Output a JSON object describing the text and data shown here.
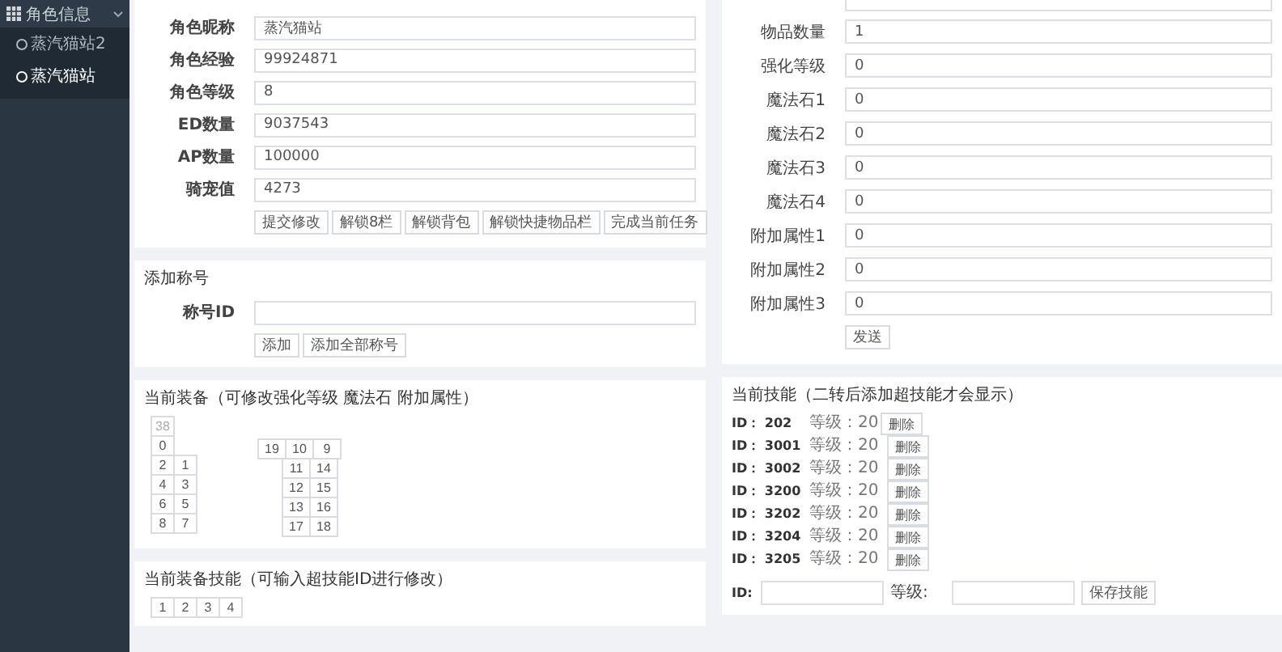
{
  "sidebar": {
    "title": "角色信息",
    "expanded": true,
    "items": [
      {
        "label": "蒸汽猫站2",
        "selected": false
      },
      {
        "label": "蒸汽猫站",
        "selected": true
      }
    ]
  },
  "character_form": {
    "fields": [
      {
        "label": "角色昵称",
        "value": "蒸汽猫站"
      },
      {
        "label": "角色经验",
        "value": "99924871"
      },
      {
        "label": "角色等级",
        "value": "8"
      },
      {
        "label": "ED数量",
        "value": "9037543"
      },
      {
        "label": "AP数量",
        "value": "100000"
      },
      {
        "label": "骑宠值",
        "value": "4273"
      }
    ],
    "buttons": [
      "提交修改",
      "解锁8栏",
      "解锁背包",
      "解锁快捷物品栏",
      "完成当前任务"
    ]
  },
  "title_form": {
    "heading": "添加称号",
    "field_label": "称号ID",
    "buttons": [
      "添加",
      "添加全部称号"
    ]
  },
  "equipment": {
    "heading": "当前装备（可修改强化等级 魔法石 附加属性）",
    "left_rows": [
      [
        {
          "label": "38",
          "disabled": true
        }
      ],
      [
        {
          "label": "0",
          "disabled": false
        }
      ],
      [
        {
          "label": "2",
          "disabled": false
        },
        {
          "label": "1",
          "disabled": false
        }
      ],
      [
        {
          "label": "4",
          "disabled": false
        },
        {
          "label": "3",
          "disabled": false
        }
      ],
      [
        {
          "label": "6",
          "disabled": false
        },
        {
          "label": "5",
          "disabled": false
        }
      ],
      [
        {
          "label": "8",
          "disabled": false
        },
        {
          "label": "7",
          "disabled": false
        }
      ]
    ],
    "right_rows": [
      [
        {
          "label": "19",
          "disabled": false
        },
        {
          "label": "10",
          "disabled": false
        },
        {
          "label": "9",
          "disabled": false
        }
      ],
      [
        {
          "label": "11",
          "disabled": false
        },
        {
          "label": "14",
          "disabled": false
        }
      ],
      [
        {
          "label": "12",
          "disabled": false
        },
        {
          "label": "15",
          "disabled": false
        }
      ],
      [
        {
          "label": "13",
          "disabled": false
        },
        {
          "label": "16",
          "disabled": false
        }
      ],
      [
        {
          "label": "17",
          "disabled": false
        },
        {
          "label": "18",
          "disabled": false
        }
      ]
    ]
  },
  "equipment_skills": {
    "heading": "当前装备技能（可输入超技能ID进行修改）",
    "slots": [
      "1",
      "2",
      "3",
      "4"
    ]
  },
  "item_form": {
    "fields": [
      {
        "label": "物品数量",
        "value": "1"
      },
      {
        "label": "强化等级",
        "value": "0"
      },
      {
        "label": "魔法石1",
        "value": "0"
      },
      {
        "label": "魔法石2",
        "value": "0"
      },
      {
        "label": "魔法石3",
        "value": "0"
      },
      {
        "label": "魔法石4",
        "value": "0"
      },
      {
        "label": "附加属性1",
        "value": "0"
      },
      {
        "label": "附加属性2",
        "value": "0"
      },
      {
        "label": "附加属性3",
        "value": "0"
      }
    ],
    "button": "发送"
  },
  "skills": {
    "heading": "当前技能（二转后添加超技能才会显示）",
    "rows": [
      {
        "id_label": "ID：",
        "id": "202",
        "level_label": "等级：",
        "level": "20",
        "button": "删除"
      },
      {
        "id_label": "ID：",
        "id": "3001",
        "level_label": "等级：",
        "level": "20",
        "button": "删除"
      },
      {
        "id_label": "ID：",
        "id": "3002",
        "level_label": "等级：",
        "level": "20",
        "button": "删除"
      },
      {
        "id_label": "ID：",
        "id": "3200",
        "level_label": "等级：",
        "level": "20",
        "button": "删除"
      },
      {
        "id_label": "ID：",
        "id": "3202",
        "level_label": "等级：",
        "level": "20",
        "button": "删除"
      },
      {
        "id_label": "ID：",
        "id": "3204",
        "level_label": "等级：",
        "level": "20",
        "button": "删除"
      },
      {
        "id_label": "ID：",
        "id": "3205",
        "level_label": "等级：",
        "level": "20",
        "button": "删除"
      }
    ],
    "id_field_label": "ID:",
    "level_field_label": "等级:",
    "save_button": "保存技能"
  }
}
